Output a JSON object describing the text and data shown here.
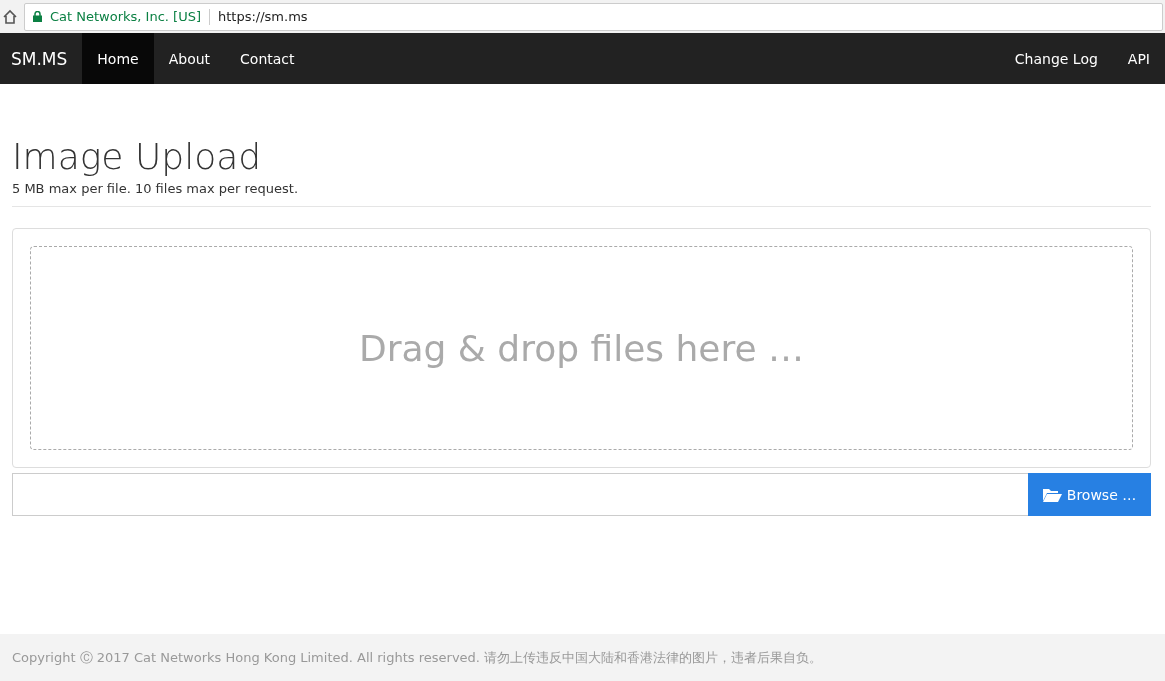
{
  "browser": {
    "site_identity": "Cat Networks, Inc. [US]",
    "url": "https://sm.ms"
  },
  "navbar": {
    "brand": "SM.MS",
    "items": [
      {
        "label": "Home",
        "selected": true
      },
      {
        "label": "About",
        "selected": false
      },
      {
        "label": "Contact",
        "selected": false
      }
    ],
    "right_items": [
      "Change Log",
      "API"
    ]
  },
  "header": {
    "title": "Image Upload",
    "subtitle": "5 MB max per file. 10 files max per request."
  },
  "dropzone": {
    "text": "Drag & drop files here …"
  },
  "browse_button": "Browse …",
  "footer": "Copyright Ⓒ 2017 Cat Networks Hong Kong Limited. All rights reserved. 请勿上传违反中国大陆和香港法律的图片，违者后果自负。"
}
